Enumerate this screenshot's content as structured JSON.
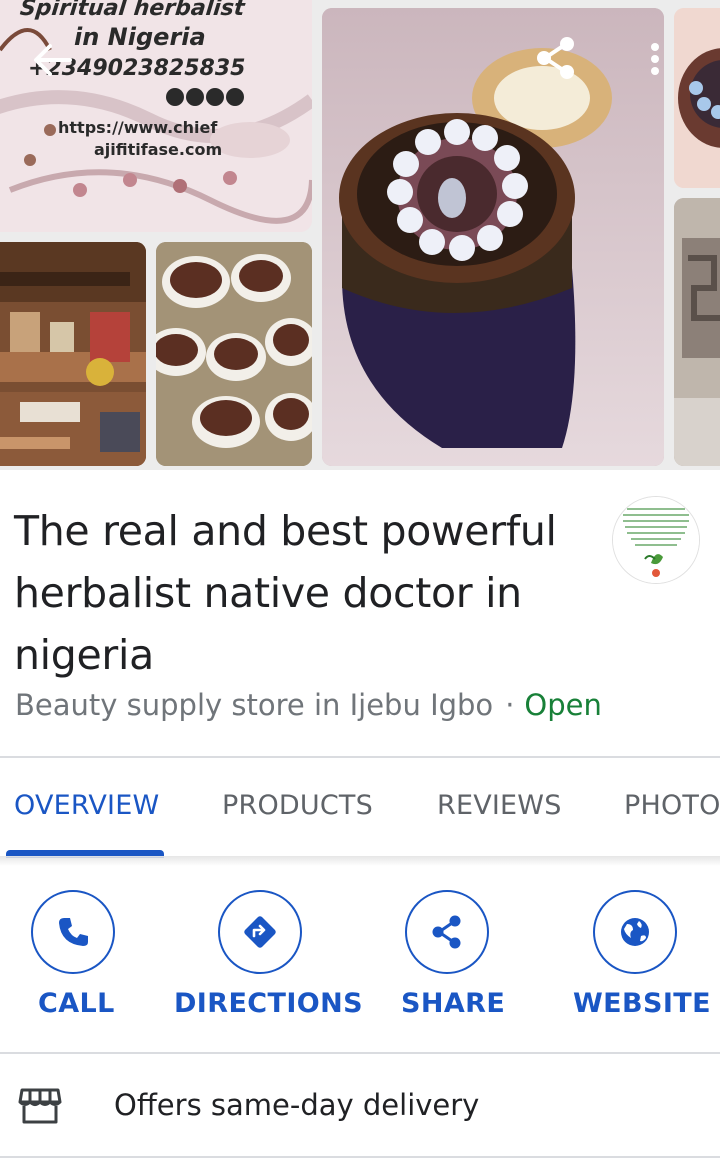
{
  "gallery": {
    "watermark": {
      "line1": "Spiritual herbalist",
      "line2": "in Nigeria",
      "line3": "+2349023825835",
      "line4": "https://www.chief",
      "line5": "ajifitifase.com"
    },
    "photos": [
      "watermark-photo",
      "shrine-photo",
      "seeds-photo",
      "cake-photo",
      "side-photo-1",
      "side-photo-2"
    ]
  },
  "header": {
    "back_icon": "arrow-left-icon",
    "share_icon": "share-icon",
    "more_icon": "more-vertical-icon"
  },
  "business": {
    "title": "The real and best powerful herbalist native doctor in nigeria",
    "category": "Beauty supply store in Ijebu Igbo",
    "separator": "·",
    "status": "Open"
  },
  "tabs": [
    {
      "label": "OVERVIEW",
      "active": true
    },
    {
      "label": "PRODUCTS",
      "active": false
    },
    {
      "label": "REVIEWS",
      "active": false
    },
    {
      "label": "PHOTO",
      "active": false
    }
  ],
  "actions": [
    {
      "label": "CALL",
      "icon": "phone-icon"
    },
    {
      "label": "DIRECTIONS",
      "icon": "directions-icon"
    },
    {
      "label": "SHARE",
      "icon": "share-icon"
    },
    {
      "label": "WEBSITE",
      "icon": "globe-icon"
    }
  ],
  "delivery": {
    "icon": "store-icon",
    "text": "Offers same-day delivery"
  },
  "colors": {
    "accent": "#1a56c4",
    "open": "#188038",
    "text_primary": "#202124",
    "text_secondary": "#70757a",
    "divider": "#dadce0"
  }
}
